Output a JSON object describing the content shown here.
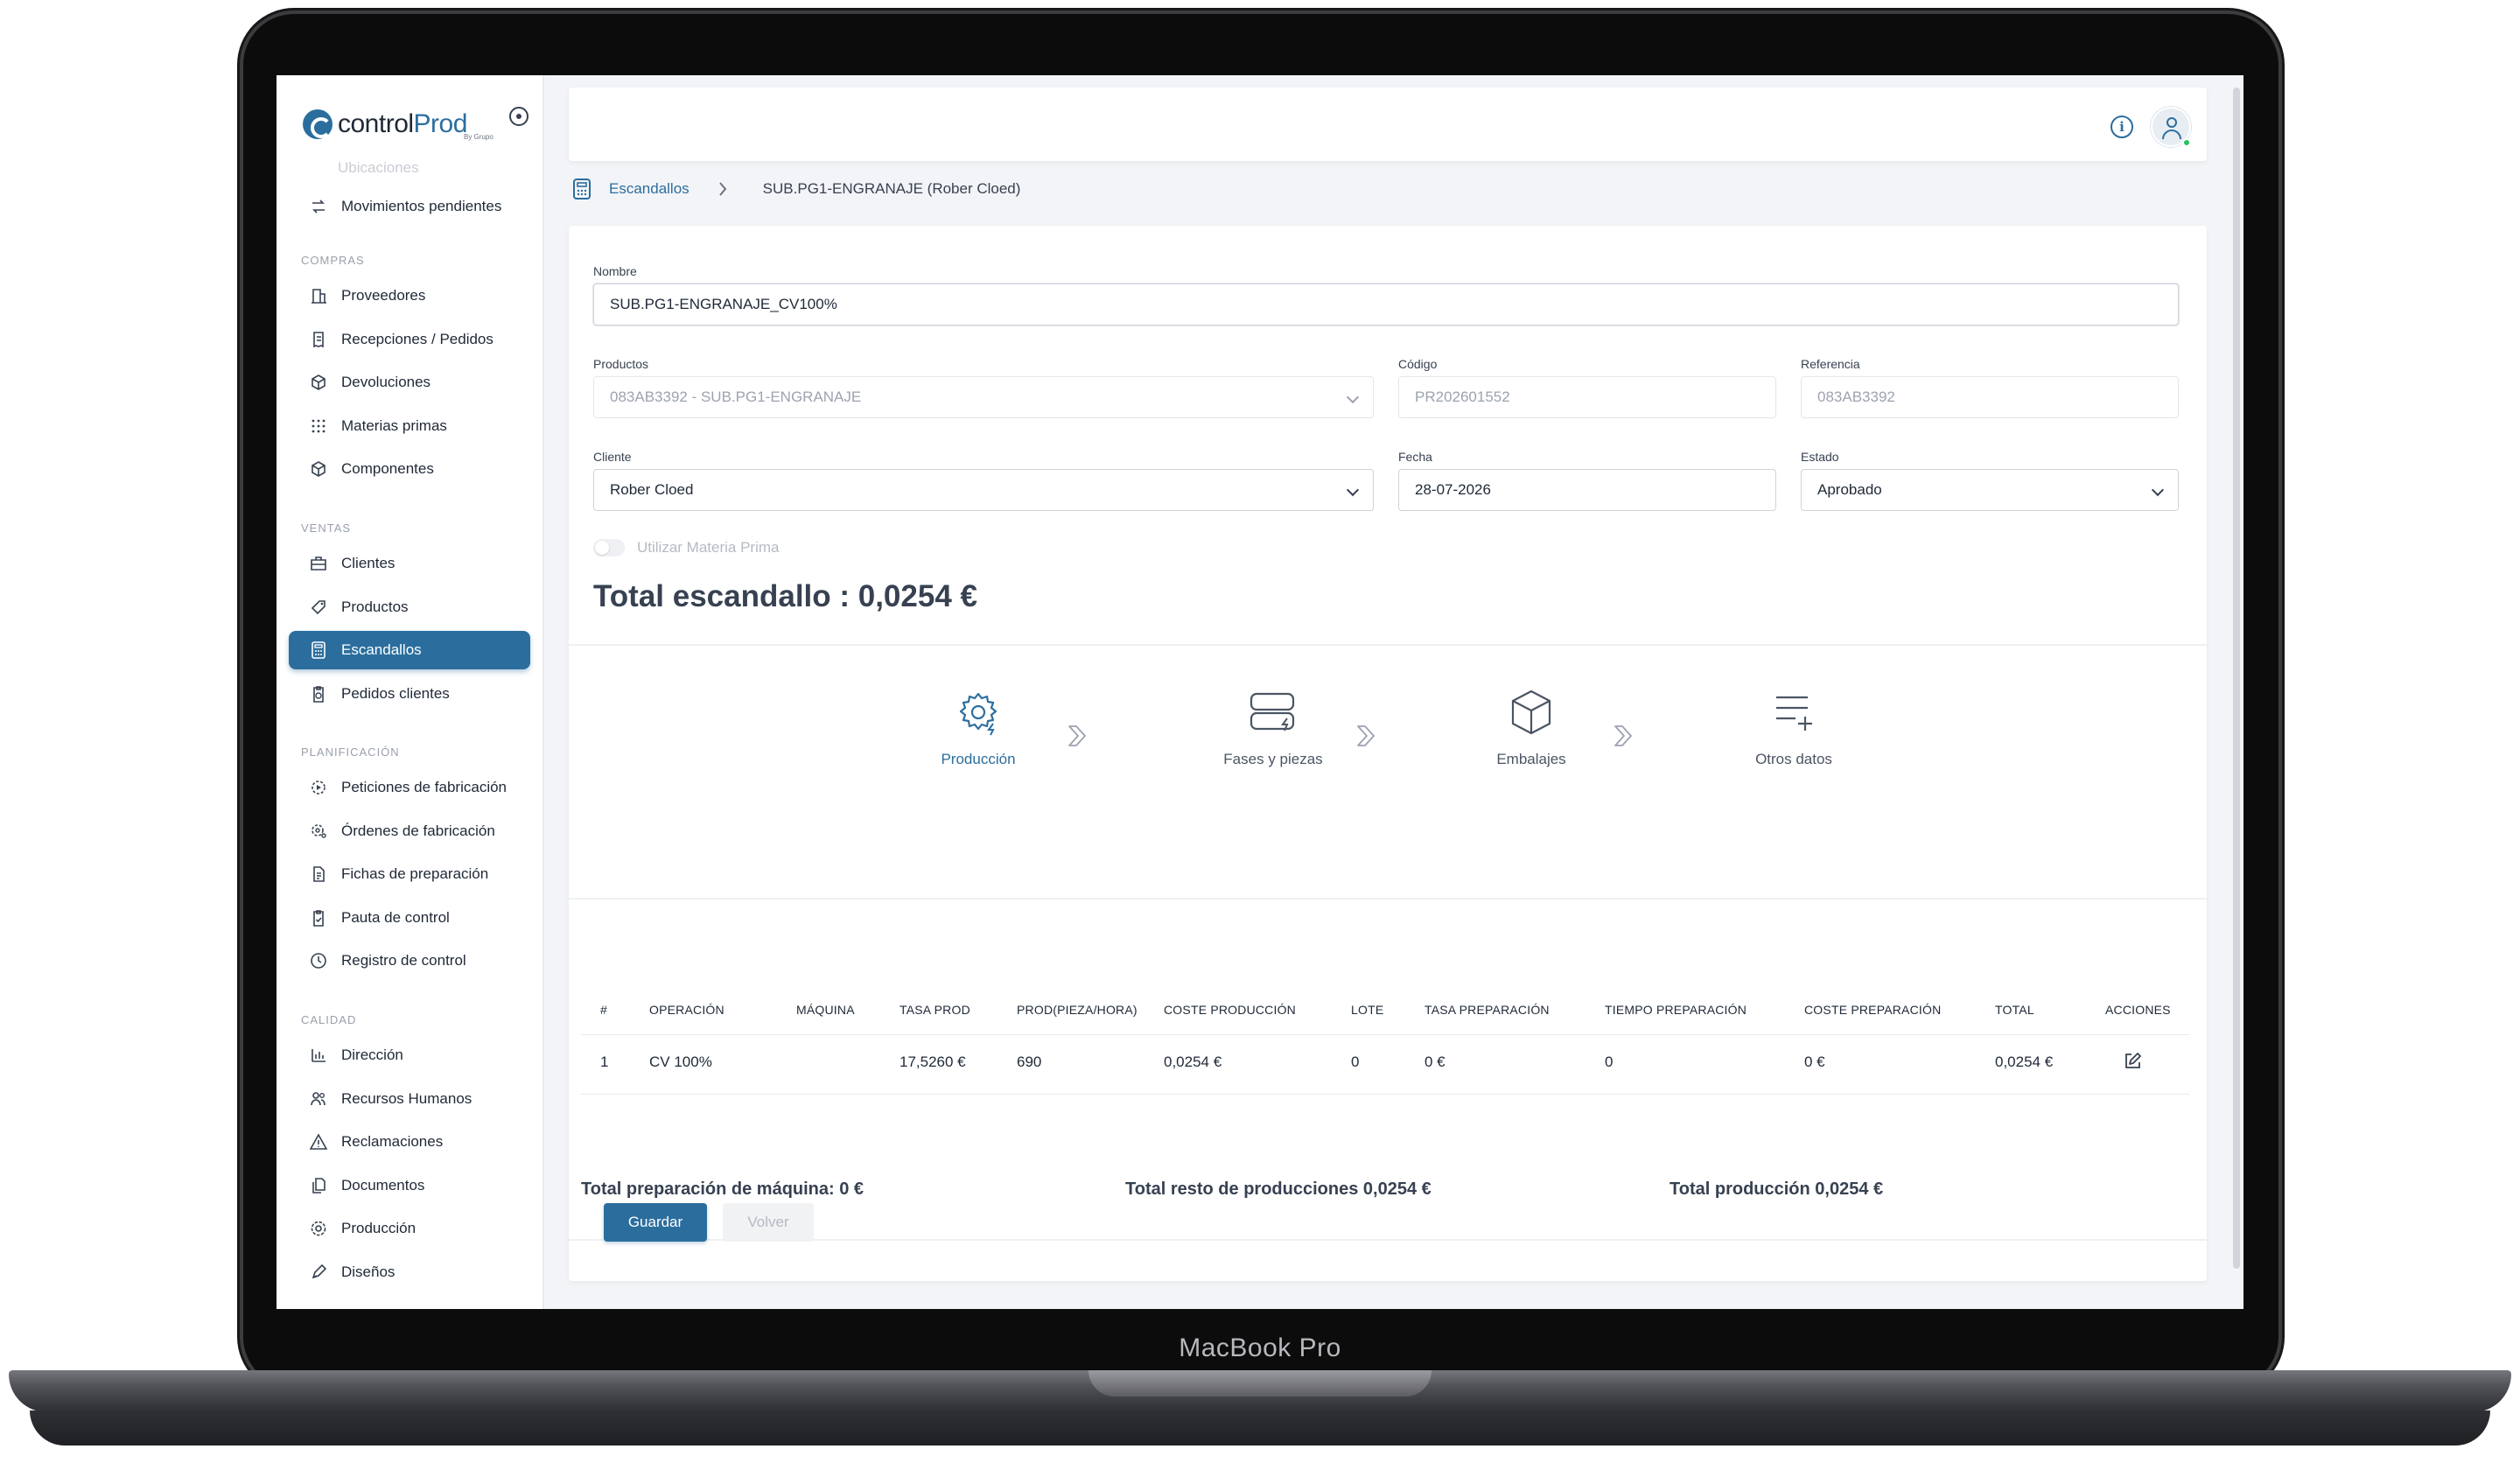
{
  "device": {
    "label": "MacBook Pro"
  },
  "brand": {
    "name_a": "control",
    "name_b": "Prod",
    "sub": "By Grupo"
  },
  "sidebar": {
    "faded_item": "Ubicaciones",
    "top_items": [
      {
        "label": "Movimientos pendientes",
        "icon": "transfer-icon"
      }
    ],
    "sections": [
      {
        "title": "COMPRAS",
        "items": [
          {
            "label": "Proveedores",
            "icon": "building-icon"
          },
          {
            "label": "Recepciones / Pedidos",
            "icon": "receipt-icon"
          },
          {
            "label": "Devoluciones",
            "icon": "return-box-icon"
          },
          {
            "label": "Materias primas",
            "icon": "grid-dots-icon"
          },
          {
            "label": "Componentes",
            "icon": "cube-icon"
          }
        ]
      },
      {
        "title": "VENTAS",
        "items": [
          {
            "label": "Clientes",
            "icon": "briefcase-icon"
          },
          {
            "label": "Productos",
            "icon": "tag-icon"
          },
          {
            "label": "Escandallos",
            "icon": "calculator-icon",
            "active": true
          },
          {
            "label": "Pedidos clientes",
            "icon": "clipboard-icon"
          }
        ]
      },
      {
        "title": "PLANIFICACIÓN",
        "items": [
          {
            "label": "Peticiones de fabricación",
            "icon": "gear-play-icon"
          },
          {
            "label": "Órdenes de fabricación",
            "icon": "gear-user-icon"
          },
          {
            "label": "Fichas de preparación",
            "icon": "document-icon"
          },
          {
            "label": "Pauta de control",
            "icon": "clipboard-check-icon"
          },
          {
            "label": "Registro de control",
            "icon": "clock-icon"
          }
        ]
      },
      {
        "title": "CALIDAD",
        "items": [
          {
            "label": "Dirección",
            "icon": "chart-icon"
          },
          {
            "label": "Recursos Humanos",
            "icon": "people-icon"
          },
          {
            "label": "Reclamaciones",
            "icon": "warning-icon"
          },
          {
            "label": "Documentos",
            "icon": "documents-icon"
          },
          {
            "label": "Producción",
            "icon": "gear-icon"
          },
          {
            "label": "Diseños",
            "icon": "pen-icon"
          }
        ]
      }
    ]
  },
  "breadcrumb": {
    "root": "Escandallos",
    "current": "SUB.PG1-ENGRANAJE (Rober Cloed)"
  },
  "form": {
    "nombre_label": "Nombre",
    "nombre_value": "SUB.PG1-ENGRANAJE_CV100%",
    "productos_label": "Productos",
    "productos_value": "083AB3392 - SUB.PG1-ENGRANAJE",
    "codigo_label": "Código",
    "codigo_value": "PR202601552",
    "referencia_label": "Referencia",
    "referencia_value": "083AB3392",
    "cliente_label": "Cliente",
    "cliente_value": "Rober Cloed",
    "fecha_label": "Fecha",
    "fecha_value": "28-07-2026",
    "estado_label": "Estado",
    "estado_value": "Aprobado",
    "toggle_label": "Utilizar Materia Prima"
  },
  "total_title": "Total escandallo : 0,0254 €",
  "steps": [
    {
      "label": "Producción",
      "icon": "gear-settings-icon",
      "active": true
    },
    {
      "label": "Fases y piezas",
      "icon": "server-bolt-icon"
    },
    {
      "label": "Embalajes",
      "icon": "box-icon"
    },
    {
      "label": "Otros datos",
      "icon": "list-add-icon"
    }
  ],
  "table": {
    "headers": [
      "#",
      "OPERACIÓN",
      "MÁQUINA",
      "TASA PROD",
      "PROD(PIEZA/HORA)",
      "COSTE PRODUCCIÓN",
      "LOTE",
      "TASA PREPARACIÓN",
      "TIEMPO PREPARACIÓN",
      "COSTE PREPARACIÓN",
      "TOTAL",
      "ACCIONES"
    ],
    "rows": [
      [
        "1",
        "CV 100%",
        "",
        "17,5260 €",
        "690",
        "0,0254 €",
        "0",
        "0 €",
        "0",
        "0 €",
        "0,0254 €"
      ]
    ]
  },
  "summary": {
    "maquina": "Total preparación de máquina: 0 €",
    "resto": "Total resto de producciones 0,0254 €",
    "produccion": "Total producción 0,0254 €"
  },
  "buttons": {
    "save": "Guardar",
    "back": "Volver"
  },
  "colors": {
    "primary": "#2b6e9e",
    "text": "#1f2937",
    "muted": "#9ca3af"
  }
}
